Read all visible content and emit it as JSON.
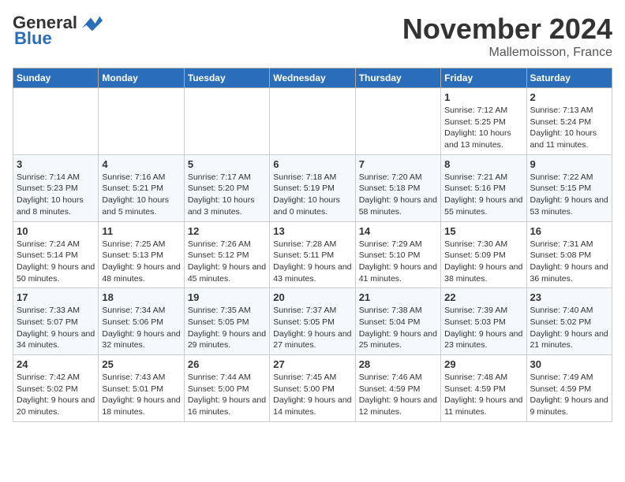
{
  "header": {
    "logo_general": "General",
    "logo_blue": "Blue",
    "title": "November 2024",
    "location": "Mallemoisson, France"
  },
  "days_of_week": [
    "Sunday",
    "Monday",
    "Tuesday",
    "Wednesday",
    "Thursday",
    "Friday",
    "Saturday"
  ],
  "weeks": [
    [
      {
        "day": "",
        "content": ""
      },
      {
        "day": "",
        "content": ""
      },
      {
        "day": "",
        "content": ""
      },
      {
        "day": "",
        "content": ""
      },
      {
        "day": "",
        "content": ""
      },
      {
        "day": "1",
        "content": "Sunrise: 7:12 AM\nSunset: 5:25 PM\nDaylight: 10 hours and 13 minutes."
      },
      {
        "day": "2",
        "content": "Sunrise: 7:13 AM\nSunset: 5:24 PM\nDaylight: 10 hours and 11 minutes."
      }
    ],
    [
      {
        "day": "3",
        "content": "Sunrise: 7:14 AM\nSunset: 5:23 PM\nDaylight: 10 hours and 8 minutes."
      },
      {
        "day": "4",
        "content": "Sunrise: 7:16 AM\nSunset: 5:21 PM\nDaylight: 10 hours and 5 minutes."
      },
      {
        "day": "5",
        "content": "Sunrise: 7:17 AM\nSunset: 5:20 PM\nDaylight: 10 hours and 3 minutes."
      },
      {
        "day": "6",
        "content": "Sunrise: 7:18 AM\nSunset: 5:19 PM\nDaylight: 10 hours and 0 minutes."
      },
      {
        "day": "7",
        "content": "Sunrise: 7:20 AM\nSunset: 5:18 PM\nDaylight: 9 hours and 58 minutes."
      },
      {
        "day": "8",
        "content": "Sunrise: 7:21 AM\nSunset: 5:16 PM\nDaylight: 9 hours and 55 minutes."
      },
      {
        "day": "9",
        "content": "Sunrise: 7:22 AM\nSunset: 5:15 PM\nDaylight: 9 hours and 53 minutes."
      }
    ],
    [
      {
        "day": "10",
        "content": "Sunrise: 7:24 AM\nSunset: 5:14 PM\nDaylight: 9 hours and 50 minutes."
      },
      {
        "day": "11",
        "content": "Sunrise: 7:25 AM\nSunset: 5:13 PM\nDaylight: 9 hours and 48 minutes."
      },
      {
        "day": "12",
        "content": "Sunrise: 7:26 AM\nSunset: 5:12 PM\nDaylight: 9 hours and 45 minutes."
      },
      {
        "day": "13",
        "content": "Sunrise: 7:28 AM\nSunset: 5:11 PM\nDaylight: 9 hours and 43 minutes."
      },
      {
        "day": "14",
        "content": "Sunrise: 7:29 AM\nSunset: 5:10 PM\nDaylight: 9 hours and 41 minutes."
      },
      {
        "day": "15",
        "content": "Sunrise: 7:30 AM\nSunset: 5:09 PM\nDaylight: 9 hours and 38 minutes."
      },
      {
        "day": "16",
        "content": "Sunrise: 7:31 AM\nSunset: 5:08 PM\nDaylight: 9 hours and 36 minutes."
      }
    ],
    [
      {
        "day": "17",
        "content": "Sunrise: 7:33 AM\nSunset: 5:07 PM\nDaylight: 9 hours and 34 minutes."
      },
      {
        "day": "18",
        "content": "Sunrise: 7:34 AM\nSunset: 5:06 PM\nDaylight: 9 hours and 32 minutes."
      },
      {
        "day": "19",
        "content": "Sunrise: 7:35 AM\nSunset: 5:05 PM\nDaylight: 9 hours and 29 minutes."
      },
      {
        "day": "20",
        "content": "Sunrise: 7:37 AM\nSunset: 5:05 PM\nDaylight: 9 hours and 27 minutes."
      },
      {
        "day": "21",
        "content": "Sunrise: 7:38 AM\nSunset: 5:04 PM\nDaylight: 9 hours and 25 minutes."
      },
      {
        "day": "22",
        "content": "Sunrise: 7:39 AM\nSunset: 5:03 PM\nDaylight: 9 hours and 23 minutes."
      },
      {
        "day": "23",
        "content": "Sunrise: 7:40 AM\nSunset: 5:02 PM\nDaylight: 9 hours and 21 minutes."
      }
    ],
    [
      {
        "day": "24",
        "content": "Sunrise: 7:42 AM\nSunset: 5:02 PM\nDaylight: 9 hours and 20 minutes."
      },
      {
        "day": "25",
        "content": "Sunrise: 7:43 AM\nSunset: 5:01 PM\nDaylight: 9 hours and 18 minutes."
      },
      {
        "day": "26",
        "content": "Sunrise: 7:44 AM\nSunset: 5:00 PM\nDaylight: 9 hours and 16 minutes."
      },
      {
        "day": "27",
        "content": "Sunrise: 7:45 AM\nSunset: 5:00 PM\nDaylight: 9 hours and 14 minutes."
      },
      {
        "day": "28",
        "content": "Sunrise: 7:46 AM\nSunset: 4:59 PM\nDaylight: 9 hours and 12 minutes."
      },
      {
        "day": "29",
        "content": "Sunrise: 7:48 AM\nSunset: 4:59 PM\nDaylight: 9 hours and 11 minutes."
      },
      {
        "day": "30",
        "content": "Sunrise: 7:49 AM\nSunset: 4:59 PM\nDaylight: 9 hours and 9 minutes."
      }
    ]
  ]
}
